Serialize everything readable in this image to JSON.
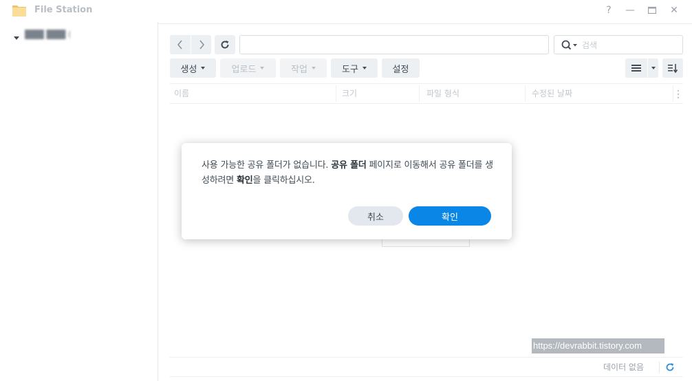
{
  "window": {
    "title": "File Station",
    "controls": [
      "?",
      "—",
      "▭",
      "✕"
    ]
  },
  "sidebar": {
    "tree": [
      {
        "label": "███ ███ (blurred)",
        "expanded": true
      }
    ]
  },
  "toolbar": {
    "search_placeholder": "검색",
    "path_value": "",
    "buttons": [
      {
        "label": "생성",
        "enabled": true,
        "dropdown": true
      },
      {
        "label": "업로드",
        "enabled": false,
        "dropdown": true
      },
      {
        "label": "작업",
        "enabled": false,
        "dropdown": true
      },
      {
        "label": "도구",
        "enabled": true,
        "dropdown": true
      },
      {
        "label": "설정",
        "enabled": true,
        "dropdown": false
      }
    ]
  },
  "table": {
    "columns": [
      "이름",
      "크기",
      "파일 형식",
      "수정된 날짜"
    ]
  },
  "footer": {
    "status": "데이터 없음"
  },
  "watermark": "https://devrabbit.tistory.com",
  "dialog": {
    "message_part1": "사용 가능한 공유 폴더가 없습니다. ",
    "message_bold1": "공유 폴더",
    "message_part2": " 페이지로 이동해서 공유 폴더를 생성하려면 ",
    "message_bold2": "확인",
    "message_part3": "을 클릭하십시오.",
    "cancel_label": "취소",
    "ok_label": "확인"
  },
  "colors": {
    "accent": "#0a86e6",
    "button_bg": "#edf0f3",
    "folder_icon": "#f6d68a"
  }
}
